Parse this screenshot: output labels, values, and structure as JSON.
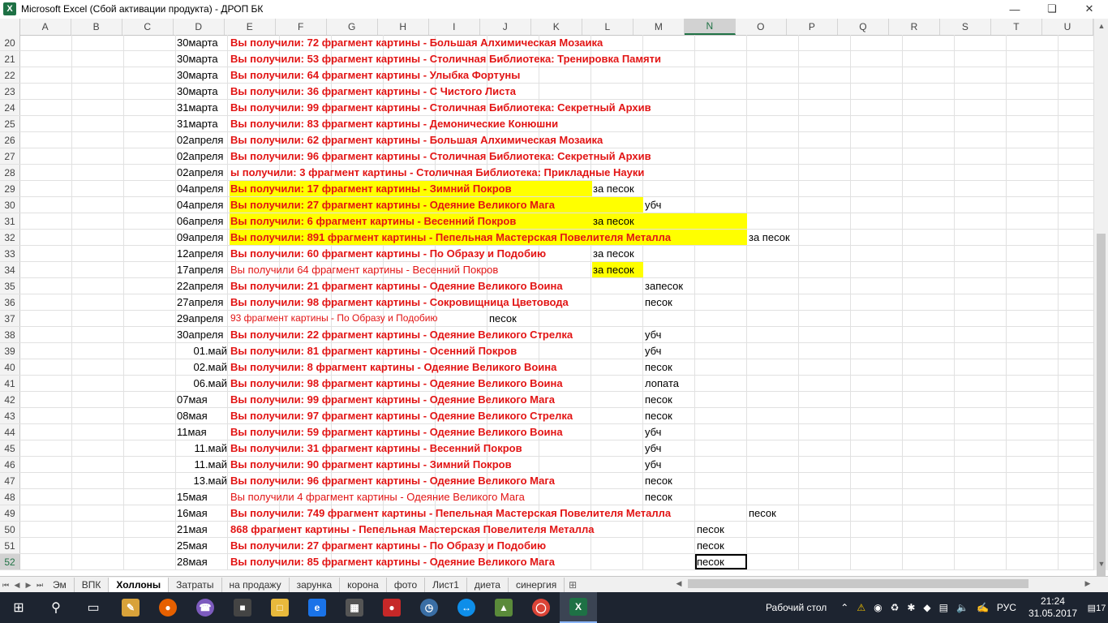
{
  "window": {
    "title": "Microsoft Excel (Сбой активации продукта) - ДРОП БК",
    "app_icon": "X"
  },
  "columns": [
    "A",
    "B",
    "C",
    "D",
    "E",
    "F",
    "G",
    "H",
    "I",
    "J",
    "K",
    "L",
    "M",
    "N",
    "O",
    "P",
    "Q",
    "R",
    "S",
    "T",
    "U"
  ],
  "selected_column": "N",
  "rows": [
    {
      "n": "20",
      "date": "30марта",
      "msg": "Вы получили: 72 фрагмент картины - Большая Алхимическая Мозаика"
    },
    {
      "n": "21",
      "date": "30марта",
      "msg": "Вы получили: 53 фрагмент картины - Столичная Библиотека: Тренировка Памяти"
    },
    {
      "n": "22",
      "date": "30марта",
      "msg": "Вы получили: 64 фрагмент картины - Улыбка Фортуны"
    },
    {
      "n": "23",
      "date": "30марта",
      "msg": "Вы получили: 36 фрагмент картины - С Чистого Листа"
    },
    {
      "n": "24",
      "date": "31марта",
      "msg": "Вы получили: 99 фрагмент картины - Столичная Библиотека: Секретный Архив"
    },
    {
      "n": "25",
      "date": "31марта",
      "msg": "Вы получили: 83 фрагмент картины - Демонические Конюшни"
    },
    {
      "n": "26",
      "date": "02апреля",
      "msg": "Вы получили: 62 фрагмент картины - Большая Алхимическая Мозаика"
    },
    {
      "n": "27",
      "date": "02апреля",
      "msg": "Вы получили: 96 фрагмент картины - Столичная Библиотека: Секретный Архив"
    },
    {
      "n": "28",
      "date": "02апреля",
      "msg": "ы получили: 3 фрагмент картины - Столичная Библиотека: Прикладные Науки"
    },
    {
      "n": "29",
      "date": "04апреля",
      "msg": "Вы получили: 17 фрагмент картины - Зимний Покров",
      "note": "за песок"
    },
    {
      "n": "30",
      "date": "04апреля",
      "msg": "Вы получили: 27 фрагмент картины - Одеяние Великого Мага",
      "note": "убч"
    },
    {
      "n": "31",
      "date": "06апреля",
      "msg": "Вы получили: 6 фрагмент картины - Весенний Покров",
      "note": "за песок"
    },
    {
      "n": "32",
      "date": "09апреля",
      "msg": "Вы получили: 891 фрагмент картины - Пепельная Мастерская Повелителя Металла",
      "note": "за песок"
    },
    {
      "n": "33",
      "date": "12апреля",
      "msg": "Вы получили: 60 фрагмент картины - По Образу и Подобию",
      "note": "за песок"
    },
    {
      "n": "34",
      "date": "17апреля",
      "msg": "Вы получили 64 фрагмент картины - Весенний Покров",
      "note": "за песок"
    },
    {
      "n": "35",
      "date": "22апреля",
      "msg": "Вы получили: 21 фрагмент картины - Одеяние Великого Воина",
      "note": "запесок"
    },
    {
      "n": "36",
      "date": "27апреля",
      "msg": "Вы получили: 98 фрагмент картины - Сокровищница Цветовода",
      "note": "песок"
    },
    {
      "n": "37",
      "date": "29апреля",
      "msg": "93 фрагмент картины - По Образу и Подобию",
      "note": "песок"
    },
    {
      "n": "38",
      "date": "30апреля",
      "msg": "Вы получили: 22 фрагмент картины - Одеяние Великого Стрелка",
      "note": "убч"
    },
    {
      "n": "39",
      "date": "01.май",
      "msg": "Вы получили: 81 фрагмент картины - Осенний Покров",
      "note": "убч"
    },
    {
      "n": "40",
      "date": "02.май",
      "msg": "Вы получили: 8 фрагмент картины - Одеяние Великого Воина",
      "note": "песок"
    },
    {
      "n": "41",
      "date": "06.май",
      "msg": "Вы получили: 98 фрагмент картины - Одеяние Великого Воина",
      "note": "лопата"
    },
    {
      "n": "42",
      "date": "07мая",
      "msg": "Вы получили: 99 фрагмент картины - Одеяние Великого Мага",
      "note": "песок"
    },
    {
      "n": "43",
      "date": "08мая",
      "msg": "Вы получили: 97 фрагмент картины - Одеяние Великого Стрелка",
      "note": "песок"
    },
    {
      "n": "44",
      "date": "11мая",
      "msg": "Вы получили: 59 фрагмент картины - Одеяние Великого Воина",
      "note": "убч"
    },
    {
      "n": "45",
      "date": "11.май",
      "msg": "Вы получили: 31 фрагмент картины - Весенний Покров",
      "note": "убч"
    },
    {
      "n": "46",
      "date": "11.май",
      "msg": "Вы получили: 90 фрагмент картины - Зимний Покров",
      "note": "убч"
    },
    {
      "n": "47",
      "date": "13.май",
      "msg": "Вы получили: 96 фрагмент картины - Одеяние Великого Мага",
      "note": "песок"
    },
    {
      "n": "48",
      "date": "15мая",
      "msg": "Вы получили 4 фрагмент картины - Одеяние Великого Мага",
      "note": "песок"
    },
    {
      "n": "49",
      "date": "16мая",
      "msg": "Вы получили: 749 фрагмент картины - Пепельная Мастерская Повелителя Металла",
      "note": "песок"
    },
    {
      "n": "50",
      "date": "21мая",
      "msg": "868 фрагмент картины - Пепельная Мастерская Повелителя Металла",
      "note": "песок"
    },
    {
      "n": "51",
      "date": "25мая",
      "msg": "Вы получили: 27 фрагмент картины - По Образу и Подобию",
      "note": "песок"
    },
    {
      "n": "52",
      "date": "28мая",
      "msg": "Вы получили: 85 фрагмент картины - Одеяние Великого Мага",
      "note": "песок"
    }
  ],
  "sheet_tabs": [
    "Эм",
    "ВПК",
    "Холлоны",
    "Затраты",
    "на продажу",
    "зарунка",
    "корона",
    "фото",
    "Лист1",
    "диета",
    "синергия"
  ],
  "active_sheet": "Холлоны",
  "taskbar": {
    "apps": [
      "start-icon",
      "search-icon",
      "task-view-icon",
      "paint-icon",
      "firefox-icon",
      "viber-icon",
      "store-icon",
      "explorer-icon",
      "edge-icon",
      "calculator-icon",
      "app-icon",
      "alarm-icon",
      "teamviewer-icon",
      "app-icon-2",
      "chrome-icon",
      "excel-icon"
    ],
    "desktop_label": "Рабочий стол",
    "language": "РУС",
    "time": "21:24",
    "date": "31.05.2017",
    "notifications": "17"
  },
  "colors": {
    "msg_red": "#e21414",
    "highlight_yellow": "#ffff00",
    "excel_green": "#217346"
  }
}
